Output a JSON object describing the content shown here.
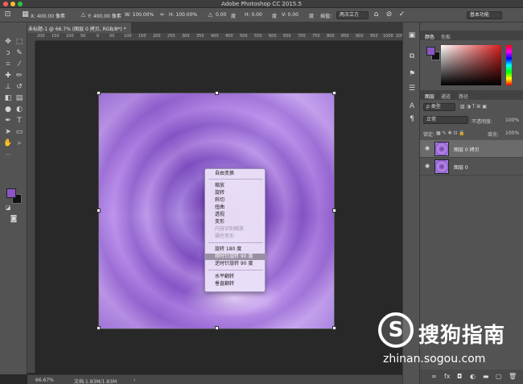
{
  "app": {
    "title": "Adobe Photoshop CC 2015.5"
  },
  "options_bar": {
    "x": "X: 400.00 像素",
    "y": "Y: 400.00 像素",
    "w": "W: 100.00%",
    "h": "H: 100.00%",
    "angle": "0.00",
    "angle_unit": "度",
    "hskew": "H: 0.00",
    "vskew": "V: 0.00",
    "interp_label": "插值：",
    "interp_value": "两次立方",
    "workspace": "基本功能"
  },
  "document": {
    "tab_title": "未标题-1 @ 66.7% (图层 0 拷贝, RGB/8*) *",
    "close_glyph": "×"
  },
  "ruler": {
    "ticks": [
      "200",
      "150",
      "100",
      "50",
      "0",
      "50",
      "100",
      "150",
      "200",
      "250",
      "300",
      "350",
      "400",
      "450",
      "500",
      "550",
      "600",
      "650",
      "700",
      "750",
      "800",
      "850",
      "900",
      "950",
      "1000",
      "1050"
    ]
  },
  "context_menu": {
    "items": [
      {
        "label": "自由变换",
        "state": "normal"
      },
      {
        "label": "缩放",
        "state": "normal"
      },
      {
        "label": "旋转",
        "state": "normal"
      },
      {
        "label": "斜切",
        "state": "normal"
      },
      {
        "label": "扭曲",
        "state": "normal"
      },
      {
        "label": "透视",
        "state": "normal"
      },
      {
        "label": "变形",
        "state": "normal"
      },
      {
        "label": "内容识别缩放",
        "state": "disabled"
      },
      {
        "label": "操控变形",
        "state": "disabled"
      },
      {
        "label": "旋转 180 度",
        "state": "normal"
      },
      {
        "label": "顺时针旋转 90 度",
        "state": "highlighted"
      },
      {
        "label": "逆时针旋转 90 度",
        "state": "normal"
      },
      {
        "label": "水平翻转",
        "state": "normal"
      },
      {
        "label": "垂直翻转",
        "state": "normal"
      }
    ]
  },
  "status": {
    "zoom": "66.67%",
    "doc": "文档:1.83M/1.83M",
    "arrow": "›"
  },
  "panels": {
    "color_tabs": [
      "颜色",
      "色板"
    ],
    "layers_tabs": [
      "图层",
      "通道",
      "路径"
    ],
    "kind_label": "ρ 类型",
    "blend_mode": "正常",
    "opacity_label": "不透明度:",
    "opacity_value": "100%",
    "lock_label": "锁定:",
    "fill_label": "填充:",
    "fill_value": "100%",
    "layers": [
      {
        "name": "图层 0 拷贝",
        "selected": true
      },
      {
        "name": "图层 0",
        "selected": false
      }
    ],
    "footer_icons": [
      "link-icon",
      "fx-icon",
      "mask-icon",
      "adjustment-icon",
      "group-icon",
      "new-layer-icon",
      "trash-icon"
    ]
  },
  "watermark": {
    "logo_letter": "S",
    "cn": "搜狗指南",
    "url": "zhinan.sogou.com"
  },
  "colors": {
    "foreground": "#8b56c6",
    "background": "#111111",
    "menu_highlight": "#9a8fa4",
    "ui_panel": "#535353"
  }
}
